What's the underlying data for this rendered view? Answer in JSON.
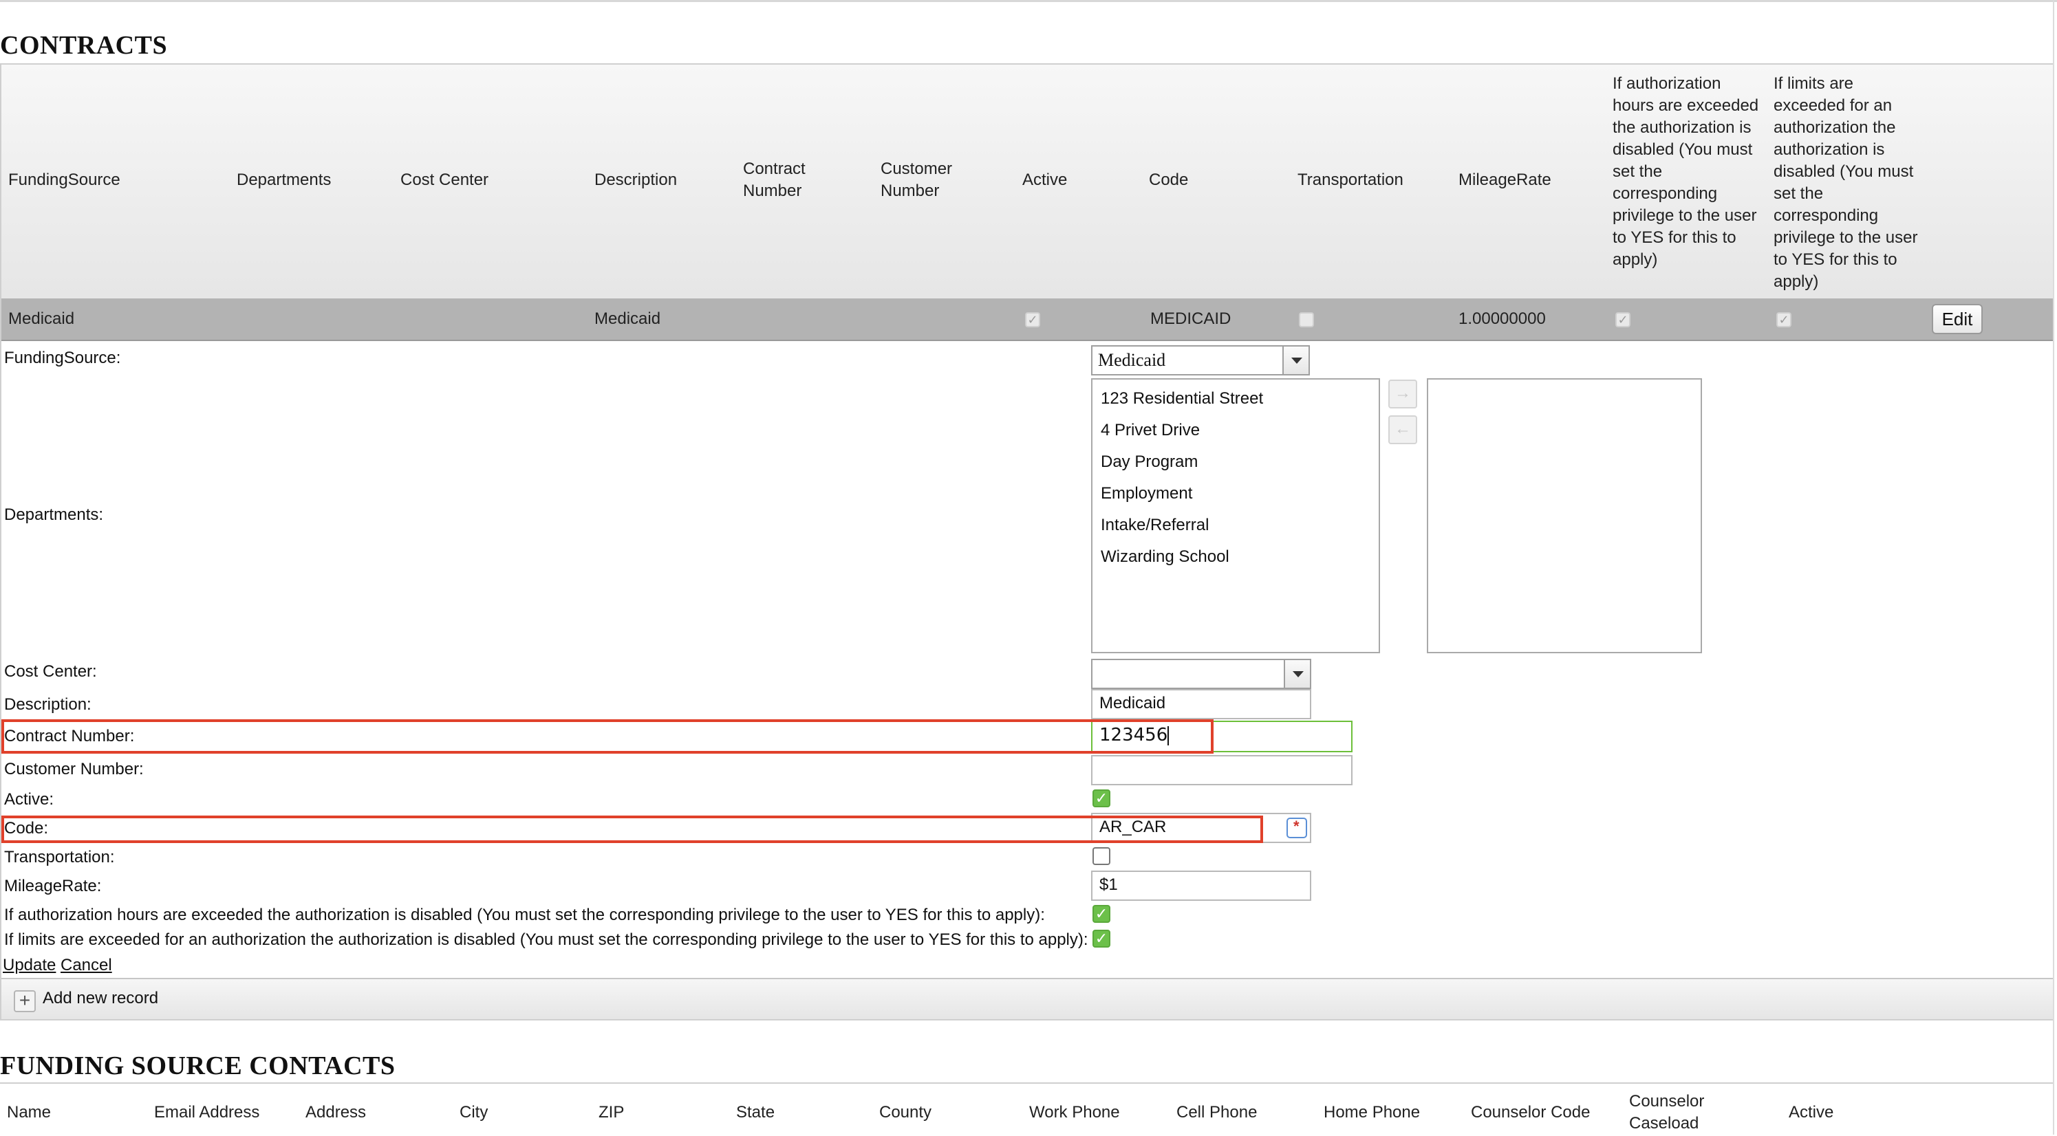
{
  "contracts_title": "CONTRACTS",
  "grid": {
    "columns": {
      "funding_source": "FundingSource",
      "departments": "Departments",
      "cost_center": "Cost Center",
      "description": "Description",
      "contract_number": "Contract Number",
      "customer_number": "Customer Number",
      "active": "Active",
      "code": "Code",
      "transportation": "Transportation",
      "mileage_rate": "MileageRate",
      "auth_hours_rule": "If authorization hours are exceeded the authorization is disabled (You must set the corresponding privilege to the user to YES for this to apply)",
      "limits_rule": "If limits are exceeded for an authorization the authorization is disabled (You must set the corresponding privilege to the user to YES for this to apply)"
    },
    "row": {
      "funding_source": "Medicaid",
      "description": "Medicaid",
      "active": true,
      "code": "MEDICAID",
      "transportation": false,
      "mileage_rate": "1.00000000",
      "auth_hours_rule": true,
      "limits_rule": true,
      "edit_label": "Edit"
    }
  },
  "form": {
    "labels": {
      "funding_source": "FundingSource:",
      "departments": "Departments:",
      "cost_center": "Cost Center:",
      "description": "Description:",
      "contract_number": "Contract Number:",
      "customer_number": "Customer Number:",
      "active": "Active:",
      "code": "Code:",
      "transportation": "Transportation:",
      "mileage_rate": "MileageRate:",
      "auth_hours_rule": "If authorization hours are exceeded the authorization is disabled (You must set the corresponding privilege to the user to YES for this to apply):",
      "limits_rule": "If limits are exceeded for an authorization the authorization is disabled (You must set the corresponding privilege to the user to YES for this to apply):"
    },
    "funding_source_selected": "Medicaid",
    "departments_available": [
      "123 Residential Street",
      "4 Privet Drive",
      "Day Program",
      "Employment",
      "Intake/Referral",
      "Wizarding School"
    ],
    "cost_center_selected": "",
    "description_value": "Medicaid",
    "contract_number_value": "123456",
    "customer_number_value": "",
    "active_checked": true,
    "code_value": "AR_CAR",
    "transportation_checked": false,
    "mileage_rate_value": "$1",
    "auth_hours_checked": true,
    "limits_checked": true,
    "update_label": "Update",
    "cancel_label": "Cancel"
  },
  "toolbar": {
    "add_new_record": "Add new record"
  },
  "contacts_title": "FUNDING SOURCE CONTACTS",
  "contacts_columns": {
    "name": "Name",
    "email": "Email Address",
    "address": "Address",
    "city": "City",
    "zip": "ZIP",
    "state": "State",
    "county": "County",
    "work_phone": "Work Phone",
    "cell_phone": "Cell Phone",
    "home_phone": "Home Phone",
    "counselor_code": "Counselor Code",
    "counselor_caseload": "Counselor Caseload",
    "active": "Active"
  },
  "colors": {
    "accent_green": "#6cc04a",
    "highlight_red": "#e0412b",
    "row_gray": "#b3b3b3"
  },
  "icons": {
    "mv_right": "arrow-right-icon",
    "mv_left": "arrow-left-icon",
    "code_field": "required-field-icon",
    "add": "plus-icon",
    "dropdown": "chevron-down-icon",
    "check": "check-icon"
  }
}
